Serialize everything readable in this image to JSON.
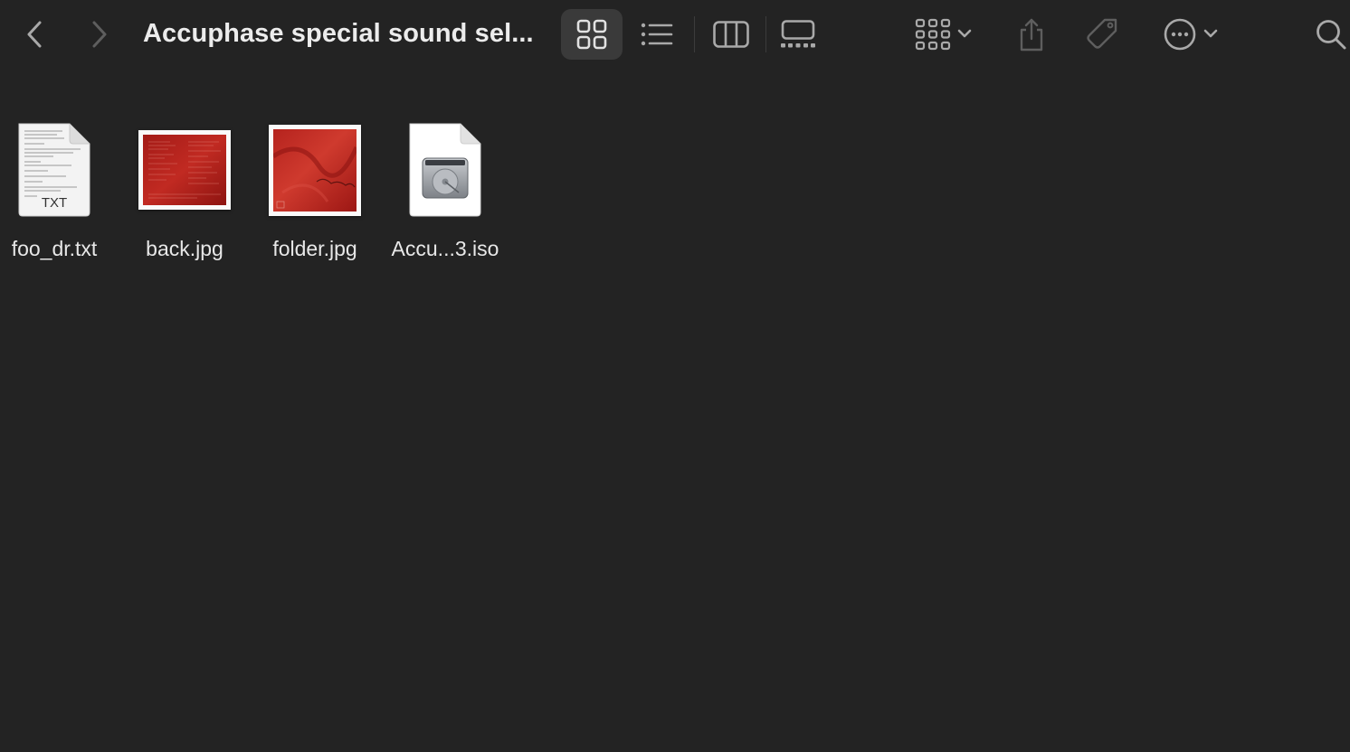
{
  "window": {
    "title": "Accuphase special sound sel..."
  },
  "toolbar": {
    "icons": {
      "back": "chevron-left-icon",
      "forward": "chevron-right-icon",
      "icon_view": "grid-icon",
      "list_view": "list-icon",
      "column_view": "columns-icon",
      "gallery_view": "gallery-icon",
      "group": "group-icon",
      "share": "share-icon",
      "tags": "tag-icon",
      "action": "ellipsis-circle-icon",
      "search": "search-icon"
    },
    "active_view": "icons"
  },
  "files": [
    {
      "name": "foo_dr.txt",
      "kind": "text-document-icon",
      "badge": "TXT"
    },
    {
      "name": "back.jpg",
      "kind": "image-thumbnail"
    },
    {
      "name": "folder.jpg",
      "kind": "image-thumbnail"
    },
    {
      "name": "Accu...3.iso",
      "kind": "disk-image-icon"
    }
  ],
  "colors": {
    "background": "#232323",
    "text": "#e8e8e8",
    "icon": "#a9a9a9",
    "selected_view_bg": "#3a3a3a",
    "cover_red": "#b3201c"
  }
}
